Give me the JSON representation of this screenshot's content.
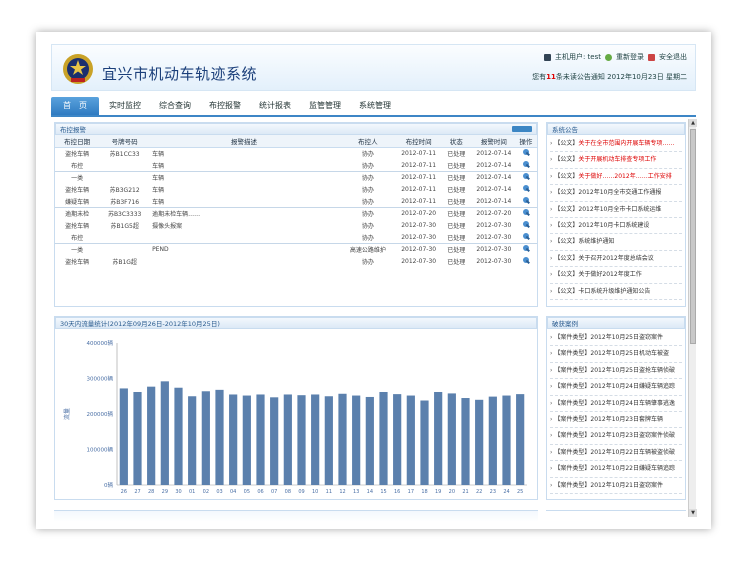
{
  "header": {
    "title": "宜兴市机动车轨迹系统",
    "links": [
      "主机用户: test",
      "重新登录",
      "安全退出"
    ],
    "greeting_pre": "您有",
    "greeting_count": "11",
    "greeting_post": "条未读公告通知   2012年10月23日 星期二"
  },
  "nav": {
    "items": [
      "首　页",
      "实时监控",
      "综合查询",
      "布控报警",
      "统计报表",
      "监管管理",
      "系统管理"
    ]
  },
  "monitor": {
    "title": "布控报警",
    "columns": [
      "布控日期",
      "号牌号码",
      "报警描述",
      "布控人",
      "布控时间",
      "状态",
      "报警时间",
      "操作"
    ],
    "rows": [
      [
        "盗抢车辆",
        "苏B1CC33",
        "车辆",
        "协办",
        "2012-07-11",
        "已处理",
        "2012-07-14",
        ""
      ],
      [
        "布控",
        "",
        "车辆",
        "协办",
        "2012-07-11",
        "已处理",
        "2012-07-14",
        ""
      ],
      [
        "一类",
        "",
        "车辆",
        "协办",
        "2012-07-11",
        "已处理",
        "2012-07-14",
        ""
      ],
      [
        "盗抢车辆",
        "苏B3G212",
        "车辆",
        "协办",
        "2012-07-11",
        "已处理",
        "2012-07-14",
        ""
      ],
      [
        "嫌疑车辆",
        "苏B3F716",
        "车辆",
        "协办",
        "2012-07-11",
        "已处理",
        "2012-07-14",
        ""
      ],
      [
        "逾期未检",
        "苏B3C3333",
        "逾期未检车辆……",
        "协办",
        "2012-07-20",
        "已处理",
        "2012-07-20",
        ""
      ],
      [
        "盗抢车辆",
        "苏B1G5超",
        "摄像头报案",
        "协办",
        "2012-07-30",
        "已处理",
        "2012-07-30",
        ""
      ],
      [
        "布控",
        "",
        "",
        "协办",
        "2012-07-30",
        "已处理",
        "2012-07-30",
        ""
      ],
      [
        "一类",
        "",
        "PEND",
        "高速公路维护",
        "2012-07-30",
        "已处理",
        "2012-07-30",
        ""
      ],
      [
        "盗抢车辆",
        "苏B1G超",
        "",
        "协办",
        "2012-07-30",
        "已处理",
        "2012-07-30",
        ""
      ]
    ]
  },
  "notice": {
    "title": "系统公告",
    "items": [
      {
        "tag": "【公文】",
        "text": "关于在全市范围内开展车辆专项……",
        "hot": true
      },
      {
        "tag": "【公文】",
        "text": "关于开展机动车排查专项工作",
        "hot": true
      },
      {
        "tag": "【公文】",
        "text": "关于做好……2012年……工作安排",
        "hot": true
      },
      {
        "tag": "【公文】",
        "text": "2012年10月全市交通工作通报",
        "hot": false
      },
      {
        "tag": "【公文】",
        "text": "2012年10月全市卡口系统运维",
        "hot": false
      },
      {
        "tag": "【公文】",
        "text": "2012年10月卡口系统建设",
        "hot": false
      },
      {
        "tag": "【公文】",
        "text": "系统维护通知",
        "hot": false
      },
      {
        "tag": "【公文】",
        "text": "关于召开2012年度总结会议",
        "hot": false
      },
      {
        "tag": "【公文】",
        "text": "关于做好2012年度工作",
        "hot": false
      },
      {
        "tag": "【公文】",
        "text": "卡口系统升级维护通知公告",
        "hot": false
      }
    ]
  },
  "chart_data": {
    "type": "bar",
    "title": "30天内流量统计(2012年09月26日-2012年10月25日)",
    "ylabel": "流量",
    "ylim": [
      0,
      400000
    ],
    "yticks_labels": [
      "0辆",
      "100000辆",
      "200000辆",
      "300000辆",
      "400000辆"
    ],
    "categories": [
      "26",
      "27",
      "28",
      "29",
      "30",
      "01",
      "02",
      "03",
      "04",
      "05",
      "06",
      "07",
      "08",
      "09",
      "10",
      "11",
      "12",
      "13",
      "14",
      "15",
      "16",
      "17",
      "18",
      "19",
      "20",
      "21",
      "22",
      "23",
      "24",
      "25"
    ],
    "values": [
      272000,
      262000,
      277000,
      292000,
      274000,
      250000,
      264000,
      268000,
      255000,
      252000,
      255000,
      247000,
      255000,
      253000,
      255000,
      250000,
      257000,
      252000,
      248000,
      262000,
      256000,
      252000,
      238000,
      262000,
      258000,
      245000,
      240000,
      249000,
      252000,
      256000
    ],
    "bar_color": "#5b80ad"
  },
  "cases": {
    "title": "破获案例",
    "items": [
      {
        "tag": "【案件类型】",
        "text": "2012年10月25日盗窃案件"
      },
      {
        "tag": "【案件类型】",
        "text": "2012年10月25日机动车被盗"
      },
      {
        "tag": "【案件类型】",
        "text": "2012年10月25日盗抢车辆侦破"
      },
      {
        "tag": "【案件类型】",
        "text": "2012年10月24日嫌疑车辆追踪"
      },
      {
        "tag": "【案件类型】",
        "text": "2012年10月24日车辆肇事逃逸"
      },
      {
        "tag": "【案件类型】",
        "text": "2012年10月23日套牌车辆"
      },
      {
        "tag": "【案件类型】",
        "text": "2012年10月23日盗窃案件侦破"
      },
      {
        "tag": "【案件类型】",
        "text": "2012年10月22日车辆被盗侦破"
      },
      {
        "tag": "【案件类型】",
        "text": "2012年10月22日嫌疑车辆追踪"
      },
      {
        "tag": "【案件类型】",
        "text": "2012年10月21日盗窃案件"
      }
    ]
  }
}
